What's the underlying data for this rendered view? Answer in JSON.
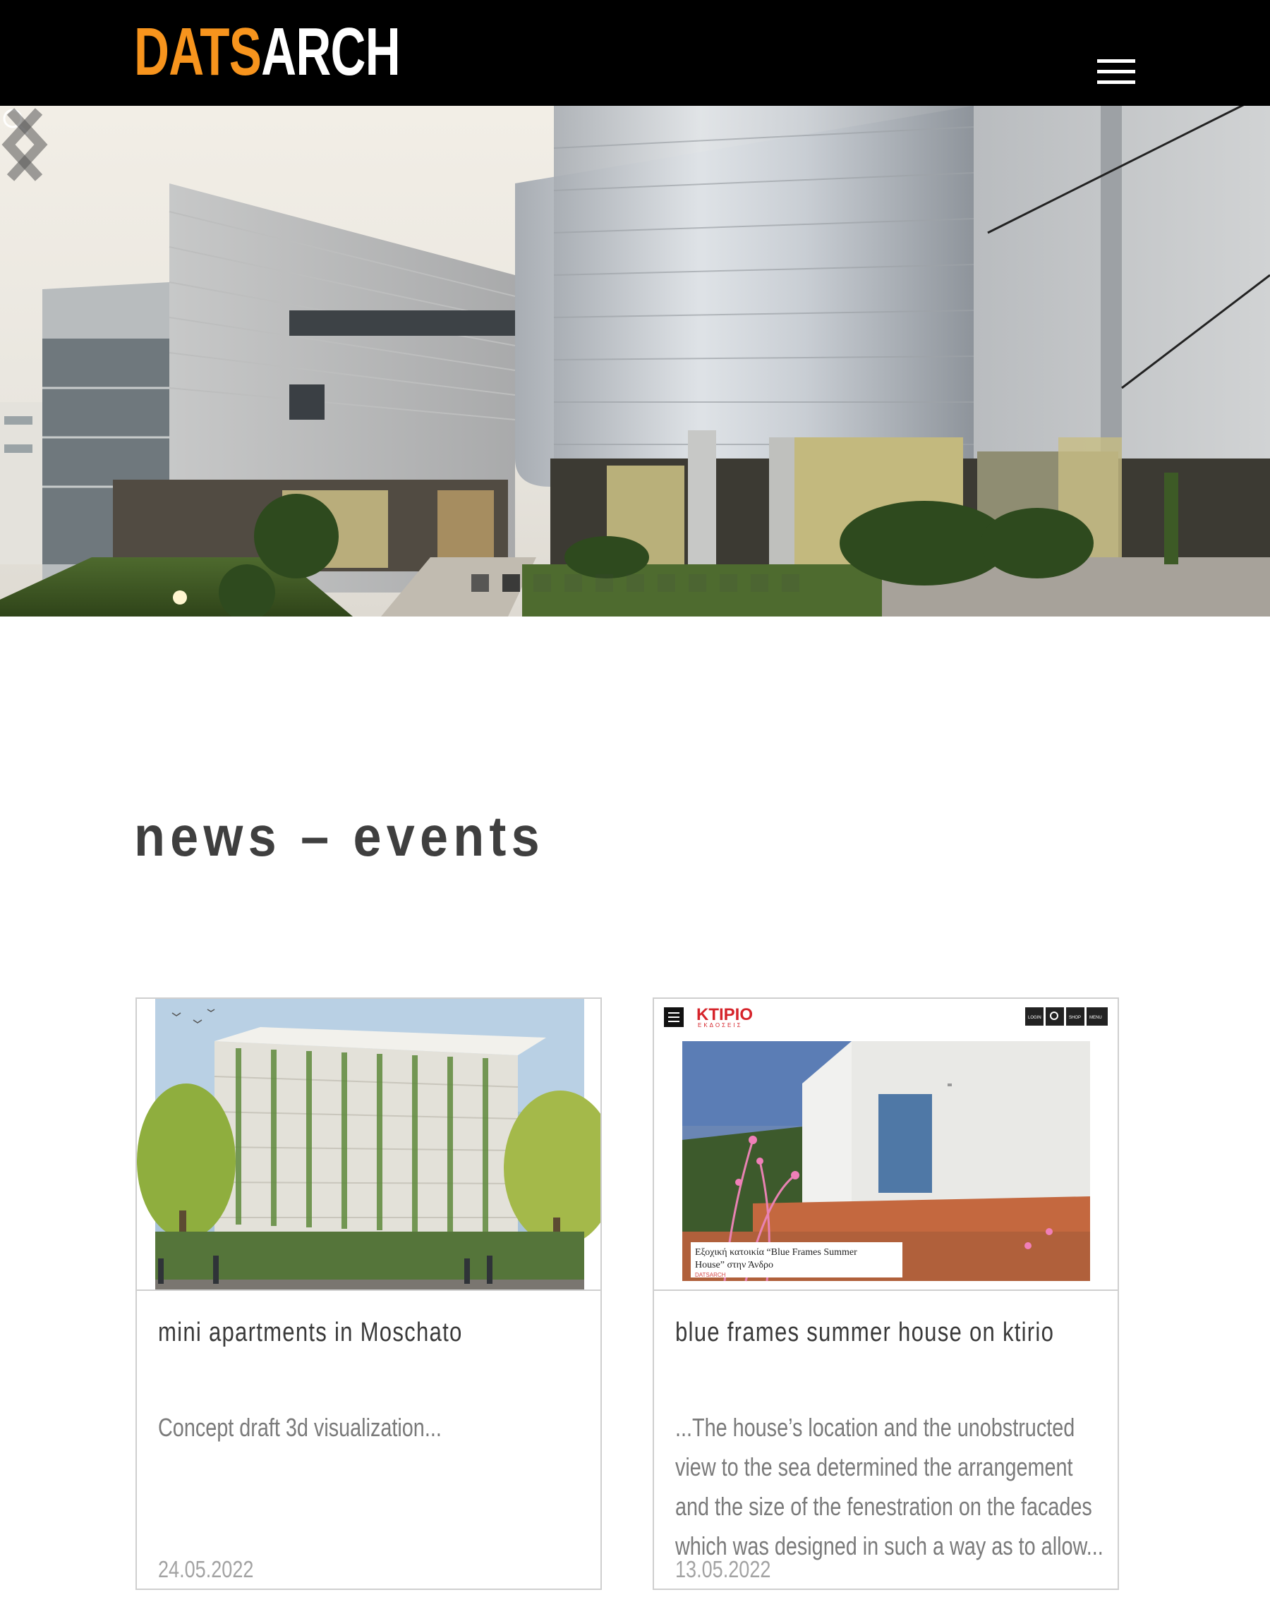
{
  "header": {
    "logo_part1": "DATS",
    "logo_part2": "ARCH",
    "menu_icon": "hamburger-menu-icon",
    "logo_colors": {
      "accent": "#f7941d",
      "light": "#ffffff"
    }
  },
  "hero": {
    "search_icon": "search-icon",
    "prev_icon": "chevron-left-icon",
    "next_icon": "chevron-right-icon",
    "slide_count": 11,
    "active_slide": 2
  },
  "section": {
    "title": "news – events"
  },
  "cards": [
    {
      "title": "mini apartments in Moschato",
      "excerpt": "Concept draft 3d visualization...",
      "date": "24.05.2022"
    },
    {
      "title": "blue frames summer house on ktirio",
      "excerpt": "...The house’s location and the unobstructed view to the sea determined the arrangement and the size of the fenestration on the facades which was designed in such a way as to allow...",
      "date": "13.05.2022",
      "thumb": {
        "brand": "ΚΤΙΡΙΟ",
        "brand_sub": "ΕΚΔΟΣΕΙΣ",
        "nav": [
          "LOGIN",
          "SHOP",
          "MENU"
        ],
        "caption_line1": "Εξοχική κατοικία “Blue Frames Summer",
        "caption_line2": "House” στην Άνδρο",
        "caption_credit": "DATSARCH"
      }
    }
  ]
}
